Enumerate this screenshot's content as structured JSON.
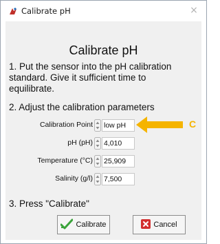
{
  "window": {
    "title": "Calibrate pH",
    "close_symbol": "×",
    "icon": "ph-app-icon"
  },
  "heading": "Calibrate pH",
  "steps": {
    "step1_lines": [
      "1. Put the sensor into the pH calibration",
      "standard. Give it sufficient time to",
      "equilibrate."
    ],
    "step2": "2. Adjust the calibration parameters",
    "step3": "3. Press \"Calibrate\""
  },
  "params": {
    "calibration_point": {
      "label": "Calibration Point",
      "value": "low pH"
    },
    "ph": {
      "label": "pH (pH)",
      "value": "4,010"
    },
    "temperature": {
      "label": "Temperature (°C)",
      "value": "25,909"
    },
    "salinity": {
      "label": "Salinity (g/l)",
      "value": "7,500"
    }
  },
  "buttons": {
    "calibrate": "Calibrate",
    "cancel": "Cancel"
  },
  "annotation": {
    "letter": "C",
    "color": "#f5b400"
  },
  "colors": {
    "accent_check": "#3aa33a",
    "cancel_red": "#d32f2f"
  }
}
